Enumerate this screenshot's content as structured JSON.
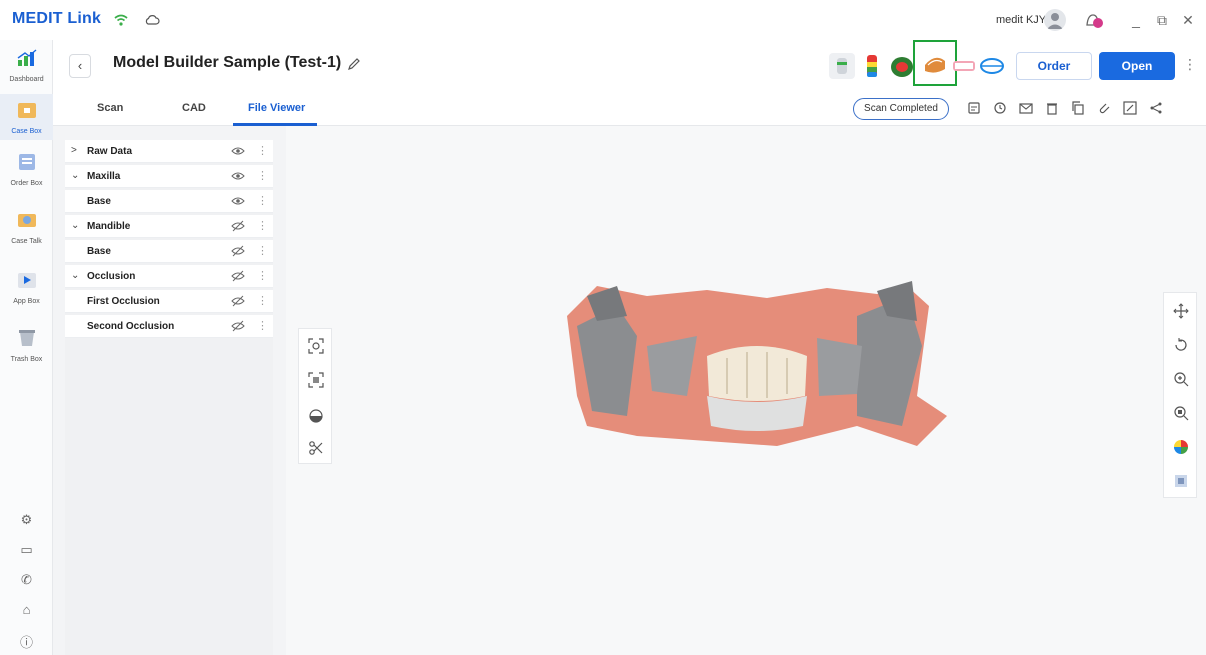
{
  "app": {
    "brand": "MEDIT Link",
    "user": "medit KJY"
  },
  "sidebar": {
    "items": [
      {
        "label": "Dashboard",
        "icon": "dashboard-icon"
      },
      {
        "label": "Case Box",
        "icon": "case-box-icon",
        "active": true
      },
      {
        "label": "Order Box",
        "icon": "order-box-icon"
      },
      {
        "label": "Case Talk",
        "icon": "case-talk-icon"
      },
      {
        "label": "App Box",
        "icon": "app-box-icon"
      },
      {
        "label": "Trash Box",
        "icon": "trash-box-icon"
      }
    ],
    "bottom_icons": [
      "settings-icon",
      "folder-icon",
      "announcement-icon",
      "home-icon",
      "info-icon"
    ]
  },
  "header": {
    "title": "Model Builder Sample (Test-1)",
    "order_label": "Order",
    "open_label": "Open",
    "app_icons": [
      "crown-app-icon",
      "heatmap-app-icon",
      "occlusion-app-icon",
      "model-builder-app-icon",
      "denture-app-icon",
      "jaw-app-icon"
    ]
  },
  "tabs": {
    "items": [
      "Scan",
      "CAD",
      "File Viewer"
    ],
    "active": "File Viewer",
    "status": "Scan Completed"
  },
  "data_panel": {
    "rows": [
      {
        "label": "Raw Data",
        "chevron": ">",
        "visible": true
      },
      {
        "label": "Maxilla",
        "chevron": "v",
        "visible": true
      },
      {
        "label": "Base",
        "chevron": "",
        "visible": true
      },
      {
        "label": "Mandible",
        "chevron": "v",
        "visible": false
      },
      {
        "label": "Base",
        "chevron": "",
        "visible": false
      },
      {
        "label": "Occlusion",
        "chevron": "v",
        "visible": false
      },
      {
        "label": "First Occlusion",
        "chevron": "",
        "visible": false
      },
      {
        "label": "Second Occlusion",
        "chevron": "",
        "visible": false
      }
    ]
  },
  "colors": {
    "accent": "#1a5fd1",
    "highlight": "#1ea33a"
  }
}
